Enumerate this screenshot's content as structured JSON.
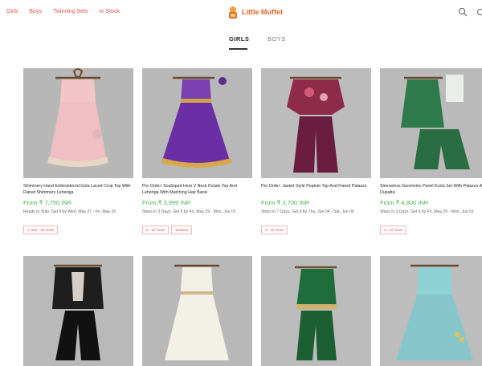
{
  "header": {
    "nav": [
      "Girls",
      "Boys",
      "Twinning Sets",
      "In Stock"
    ],
    "brand": "Little Muffet",
    "icons": {
      "search": "search-icon",
      "more": "more-icon"
    },
    "colors": {
      "accent": "#d9534f",
      "brand": "#e0682a",
      "price": "#4caf50"
    }
  },
  "tabs": [
    "GIRLS",
    "BOYS"
  ],
  "products": [
    {
      "title": "Shimmery Hand Embroidered Gota Laced Crop Top With Flared Shimmery Lehenga",
      "price": "From ₹ 7,750 INR",
      "ship": "Ready to Ship. Get it by Wed, May 27 - Fri, May 29",
      "tags": [
        "1 Year - 16 Years"
      ]
    },
    {
      "title": "Pre Order: Scalloped Hem V Neck Purple Top And Lehenga With Matching Hair Band",
      "price": "From ₹ 3,999 INR",
      "ship": "Ships in 3 Days. Get it by Fri, May 29 - Mon, Jun 01",
      "tags": [
        "0 - 15 Years",
        "Mothers"
      ]
    },
    {
      "title": "Pre Order: Jacket Style Peplum Top And Flared Palazzo",
      "price": "From ₹ 3,700 INR",
      "ship": "Ships in 7 Days. Get it by Thu, Jun 04 - Sat, Jun 06",
      "tags": [
        "0 - 12 Years"
      ]
    },
    {
      "title": "Sleeveless Geometric Panel Kurta Set With Palazzo And Dupatta",
      "price": "From ₹ 4,800 INR",
      "ship": "Ships in 3 Days. Get it by Fri, May 29 - Mon, Jun 01",
      "tags": [
        "3 - 12 Years"
      ]
    },
    {
      "title": "",
      "price": "",
      "ship": "",
      "tags": []
    },
    {
      "title": "",
      "price": "",
      "ship": "",
      "tags": []
    },
    {
      "title": "",
      "price": "",
      "ship": "",
      "tags": []
    },
    {
      "title": "",
      "price": "",
      "ship": "",
      "tags": []
    }
  ]
}
